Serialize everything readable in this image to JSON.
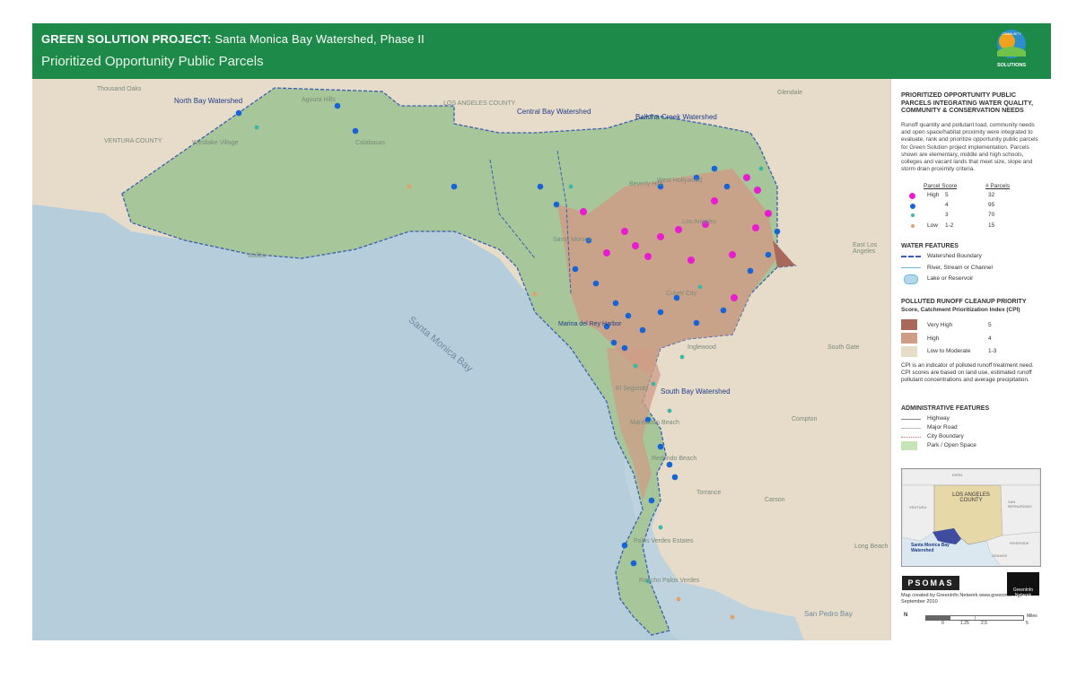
{
  "header": {
    "title_bold": "GREEN SOLUTION PROJECT:",
    "title_rest": "Santa Monica Bay Watershed, Phase II",
    "subtitle": "Prioritized Opportunity Public Parcels",
    "logo_text": "SOLUTIONS",
    "logo_top": "COMMUNITY",
    "colors": {
      "header_bg": "#1e8a4a"
    }
  },
  "map": {
    "watershed_labels": [
      "North Bay Watershed",
      "Central Bay Watershed",
      "Ballona Creek Watershed",
      "South Bay Watershed"
    ],
    "region_labels": [
      "VENTURA COUNTY",
      "LOS ANGELES COUNTY",
      "Santa Monica Bay",
      "San Pedro Bay"
    ],
    "place_labels": [
      "Thousand Oaks",
      "Agoura Hills",
      "Westlake Village",
      "Calabasas",
      "Malibu",
      "Glendale",
      "Santa Monica",
      "Beverly Hills",
      "West Hollywood",
      "Los Angeles",
      "Culver City",
      "Marina del Rey Harbor",
      "Inglewood",
      "El Segundo",
      "Manhattan Beach",
      "Redondo Beach",
      "Torrance",
      "Palos Verdes Estates",
      "Rancho Palos Verdes",
      "Compton",
      "Carson",
      "South Gate",
      "East Los Angeles",
      "Long Beach"
    ]
  },
  "legend": {
    "title": "PRIORITIZED OPPORTUNITY PUBLIC PARCELS INTEGRATING WATER QUALITY, COMMUNITY & CONSERVATION NEEDS",
    "description": "Runoff quantity and pollutant load, community needs and open space/habitat proximity were integrated to evaluate, rank and prioritize opportunity public parcels for Green Solution project implementation. Parcels shown are elementary, middle and high schools, colleges and vacant lands that meet size, slope and storm drain proximity criteria.",
    "score_header": "Parcel Score",
    "count_header": "# Parcels",
    "scores": [
      {
        "label": "High",
        "score": "5",
        "count": "32",
        "color": "#e81cd0"
      },
      {
        "label": "",
        "score": "4",
        "count": "95",
        "color": "#1565d8"
      },
      {
        "label": "",
        "score": "3",
        "count": "70",
        "color": "#3bb7a6"
      },
      {
        "label": "Low",
        "score": "1-2",
        "count": "15",
        "color": "#e0a070"
      }
    ],
    "water_title": "WATER FEATURES",
    "water_items": [
      "Watershed Boundary",
      "River, Stream or Channel",
      "Lake or Reservoir"
    ],
    "runoff_title": "POLLUTED RUNOFF CLEANUP PRIORITY",
    "runoff_subtitle": "Score, Catchment Prioritization Index (CPI)",
    "runoff_items": [
      {
        "label": "Very High",
        "value": "5",
        "color": "#a8685a"
      },
      {
        "label": "High",
        "value": "4",
        "color": "#cf9c86"
      },
      {
        "label": "Low to Moderate",
        "value": "1-3",
        "color": "#e7dcc6"
      }
    ],
    "cpi_note": "CPI is an indicator of polluted runoff treatment need. CPI scores are based on land use, estimated runoff pollutant concentrations and average precipitation.",
    "admin_title": "ADMINISTRATIVE FEATURES",
    "admin_items": [
      "Highway",
      "Major Road",
      "City Boundary",
      "Park / Open Space"
    ],
    "minimap_labels": [
      "KERN",
      "LOS ANGELES COUNTY",
      "VENTURA",
      "SAN BERNARDINO",
      "Santa Monica Bay Watershed",
      "RIVERSIDE",
      "ORANGE"
    ],
    "psomas": "PSOMAS",
    "greeninfo": "GreenInfo Network",
    "credit": "Map created by GreenInfo Network www.greeninfo.org, September 2010",
    "scale_labels": [
      "0",
      "1.25",
      "2.5",
      "5"
    ],
    "scale_unit": "Miles",
    "north": "N"
  }
}
